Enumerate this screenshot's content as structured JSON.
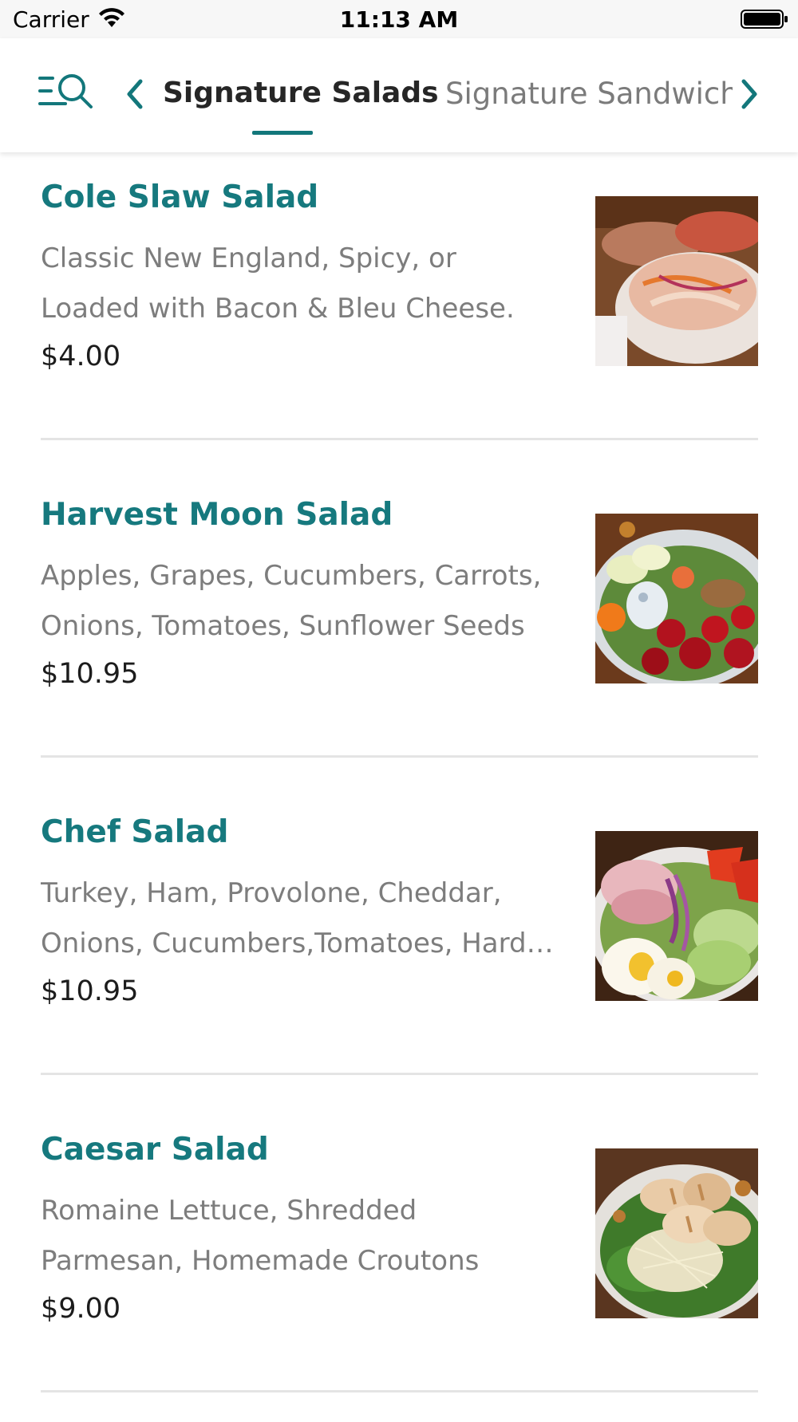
{
  "status_bar": {
    "carrier": "Carrier",
    "time": "11:13 AM"
  },
  "nav": {
    "menu_search_icon": "menu-search-icon",
    "prev_icon": "chevron-left-icon",
    "next_icon": "chevron-right-icon",
    "tabs": [
      {
        "label": "Signature Salads",
        "active": true
      },
      {
        "label": "Signature Sandwiches",
        "active": false
      }
    ],
    "accent_color": "#13777b"
  },
  "items": [
    {
      "name": "Cole Slaw Salad",
      "description": "Classic New England, Spicy, or Loaded with Bacon & Bleu Cheese.",
      "price": "$4.00"
    },
    {
      "name": "Harvest Moon Salad",
      "description": "Apples, Grapes, Cucumbers, Carrots, Onions, Tomatoes, Sunflower Seeds",
      "price": "$10.95"
    },
    {
      "name": "Chef Salad",
      "description": "Turkey, Ham, Provolone, Cheddar, Onions, Cucumbers,Tomatoes, Hard Boiled Egg",
      "price": "$10.95"
    },
    {
      "name": "Caesar Salad",
      "description": "Romaine Lettuce, Shredded Parmesan, Homemade Croutons",
      "price": "$9.00"
    }
  ]
}
